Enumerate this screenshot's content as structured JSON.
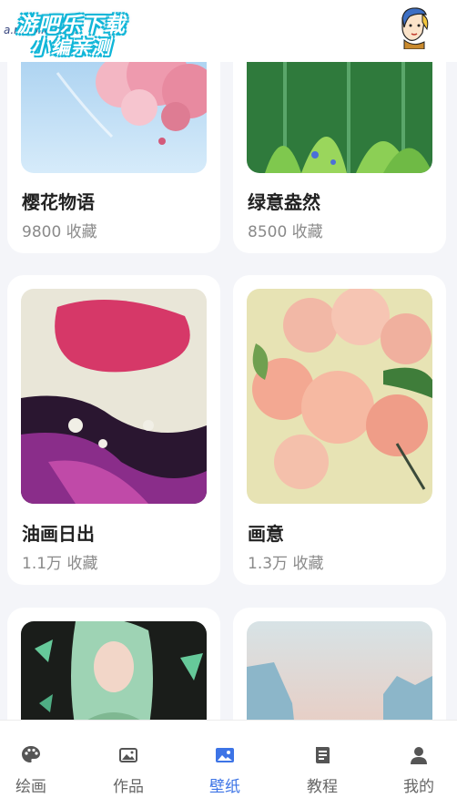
{
  "watermark": {
    "line1": "游吧乐下载",
    "line2": "小编亲测",
    "url": "a.mobile.com"
  },
  "cards": [
    {
      "title": "樱花物语",
      "favorites": "9800 收藏"
    },
    {
      "title": "绿意盎然",
      "favorites": "8500 收藏"
    },
    {
      "title": "油画日出",
      "favorites": "1.1万 收藏"
    },
    {
      "title": "画意",
      "favorites": "1.3万 收藏"
    }
  ],
  "tabs": [
    {
      "label": "绘画",
      "icon": "palette-icon"
    },
    {
      "label": "作品",
      "icon": "gallery-icon"
    },
    {
      "label": "壁纸",
      "icon": "image-icon",
      "active": true
    },
    {
      "label": "教程",
      "icon": "book-icon"
    },
    {
      "label": "我的",
      "icon": "user-icon"
    }
  ],
  "colors": {
    "accent": "#3d74e6",
    "inactive": "#666666",
    "background": "#f4f5f9"
  }
}
